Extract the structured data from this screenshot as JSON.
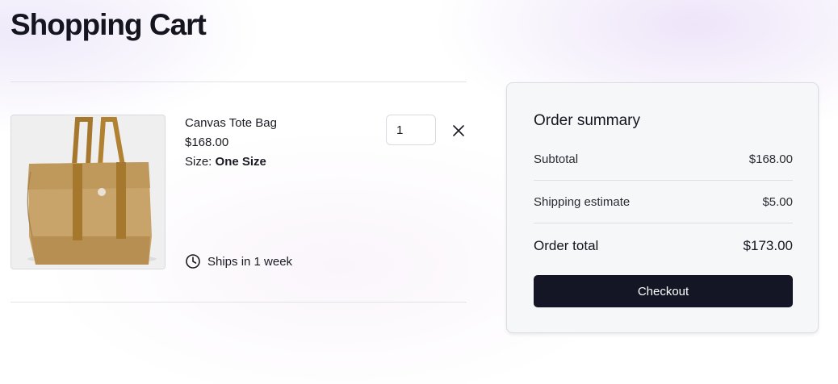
{
  "page": {
    "title": "Shopping Cart"
  },
  "cart": {
    "items": [
      {
        "image_icon": "canvas-tote-bag-image",
        "name": "Canvas Tote Bag",
        "price": "$168.00",
        "size_label": "Size:",
        "size_value": "One Size",
        "quantity": "1",
        "shipping_icon": "clock-icon",
        "shipping_text": "Ships in 1 week",
        "remove_icon": "close-icon"
      }
    ]
  },
  "summary": {
    "title": "Order summary",
    "subtotal_label": "Subtotal",
    "subtotal_value": "$168.00",
    "shipping_label": "Shipping estimate",
    "shipping_value": "$5.00",
    "total_label": "Order total",
    "total_value": "$173.00",
    "checkout_label": "Checkout"
  },
  "colors": {
    "checkout_button": "#141625",
    "summary_background": "#f6f7f9",
    "bag_canvas": "#c9a46a",
    "bag_straps": "#a5782e"
  }
}
